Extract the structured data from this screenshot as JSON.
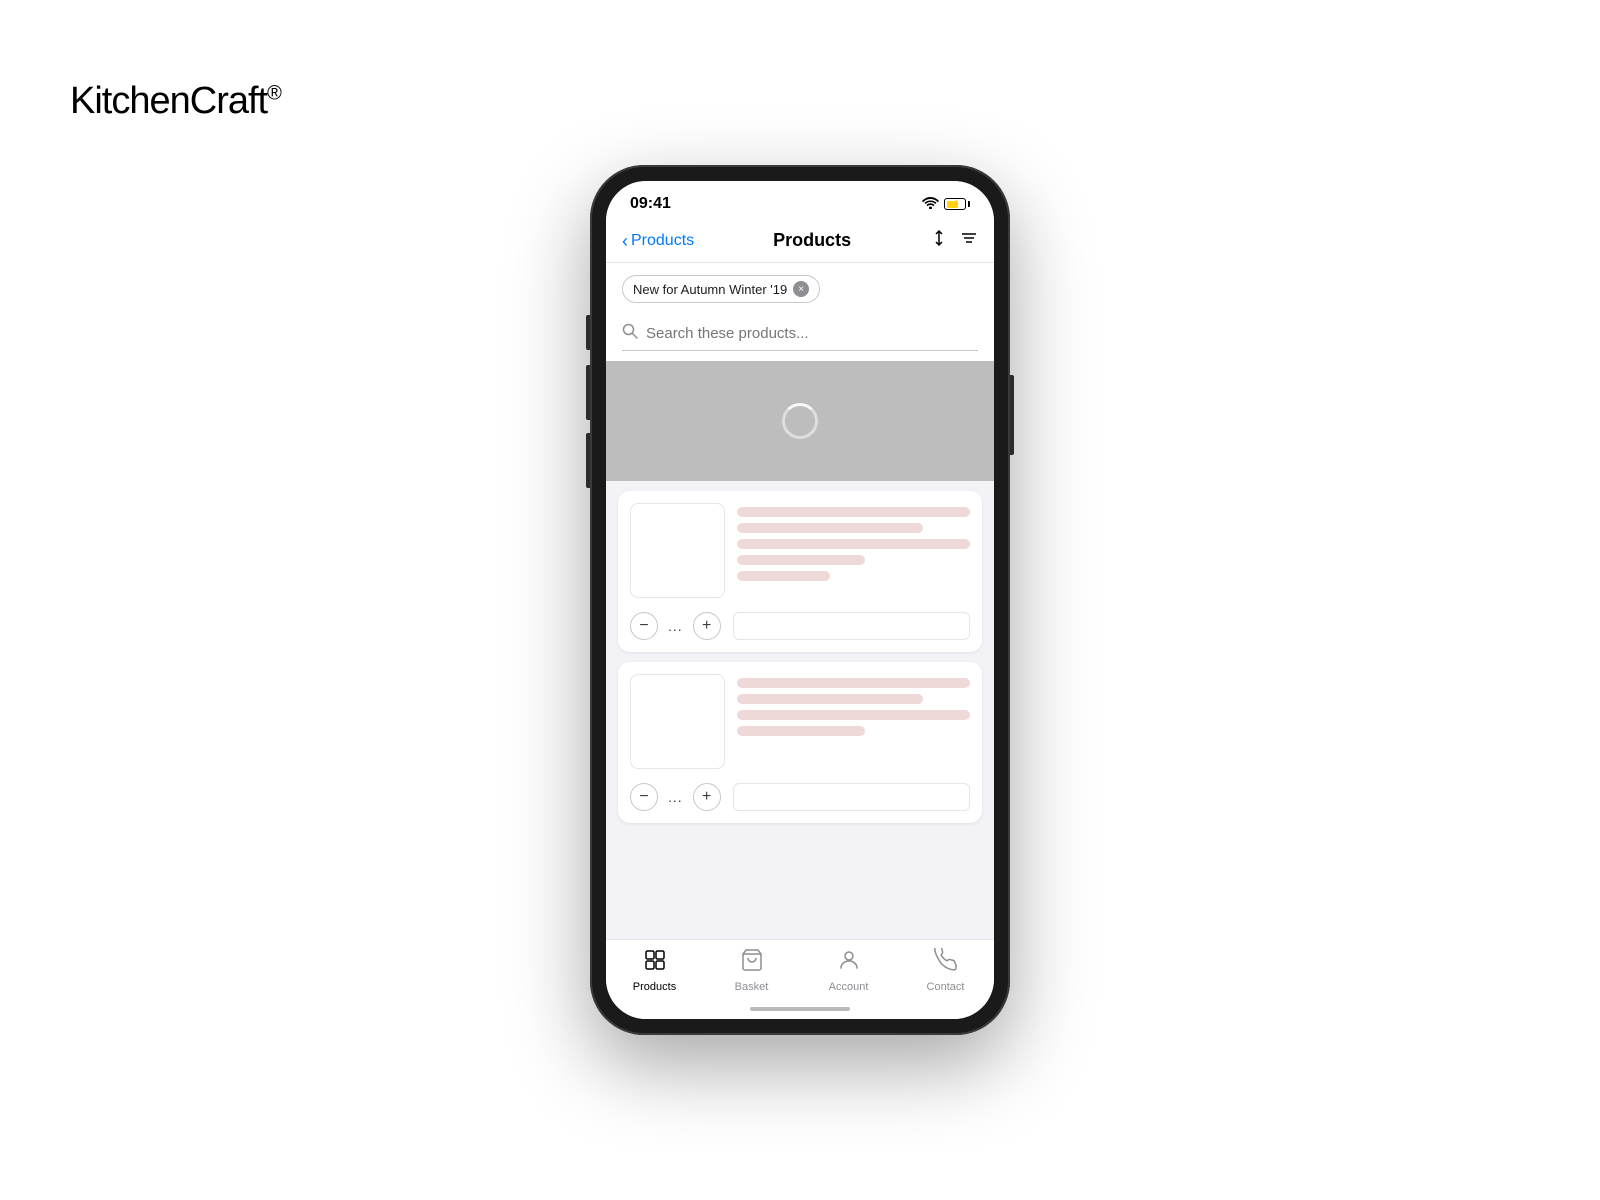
{
  "brand": {
    "name_bold": "Kitchen",
    "name_light": "Craft",
    "registered": "®"
  },
  "phone": {
    "status_bar": {
      "time": "09:41",
      "wifi": "wifi",
      "battery": "battery"
    },
    "nav": {
      "back_label": "Products",
      "title": "Products",
      "sort_label": "sort",
      "filter_label": "filter"
    },
    "filter_tag": {
      "text": "New for Autumn Winter '19",
      "close_label": "×"
    },
    "search": {
      "placeholder": "Search these products..."
    },
    "loading": {
      "aria": "Loading content"
    },
    "products": [
      {
        "id": "product-1",
        "skeleton_lines": [
          "full",
          "med",
          "full",
          "short",
          "xshort"
        ],
        "qty_minus": "−",
        "qty_dots": "...",
        "qty_plus": "+"
      },
      {
        "id": "product-2",
        "skeleton_lines": [
          "full",
          "med",
          "full",
          "short"
        ],
        "qty_minus": "−",
        "qty_dots": "...",
        "qty_plus": "+"
      }
    ],
    "tab_bar": {
      "items": [
        {
          "id": "products",
          "icon": "grid",
          "label": "Products",
          "active": true
        },
        {
          "id": "basket",
          "icon": "cart",
          "label": "Basket",
          "active": false
        },
        {
          "id": "account",
          "icon": "person",
          "label": "Account",
          "active": false
        },
        {
          "id": "contact",
          "icon": "phone",
          "label": "Contact",
          "active": false
        }
      ]
    }
  }
}
